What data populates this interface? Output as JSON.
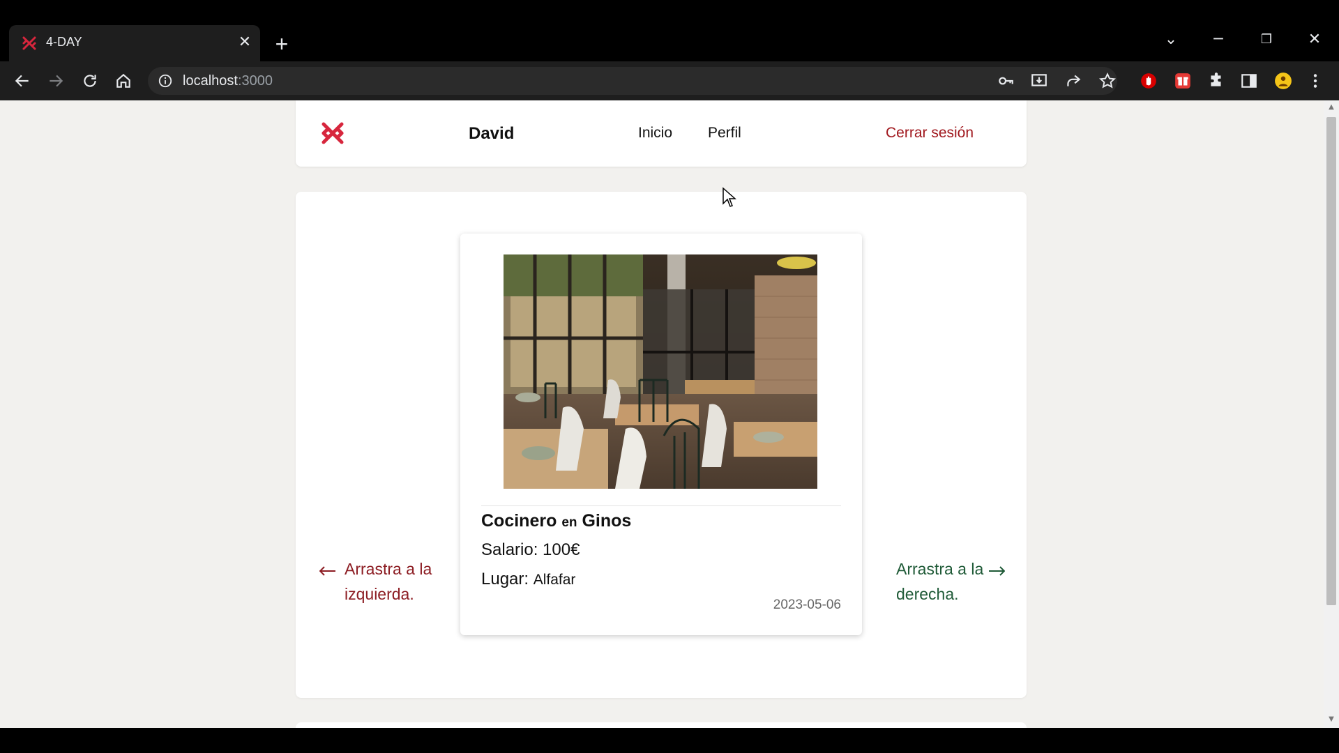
{
  "browser": {
    "tab_title": "4-DAY",
    "url_host": "localhost",
    "url_port": ":3000"
  },
  "navbar": {
    "user_name": "David",
    "links": [
      "Inicio",
      "Perfil"
    ],
    "logout_label": "Cerrar sesión"
  },
  "card": {
    "job_title": "Cocinero",
    "connector": "en",
    "company": "Ginos",
    "salary_label": "Salario:",
    "salary_value": "100€",
    "place_label": "Lugar:",
    "place_value": "Alfafar",
    "date": "2023-05-06"
  },
  "swipe": {
    "left_text": "Arrastra a la izquierda.",
    "right_text": "Arrastra a la derecha."
  },
  "colors": {
    "brand_red": "#d7263d",
    "logout": "#a0171d",
    "reject": "#8c1c22",
    "accept": "#1f5a37",
    "page_bg": "#f2f1ee"
  }
}
